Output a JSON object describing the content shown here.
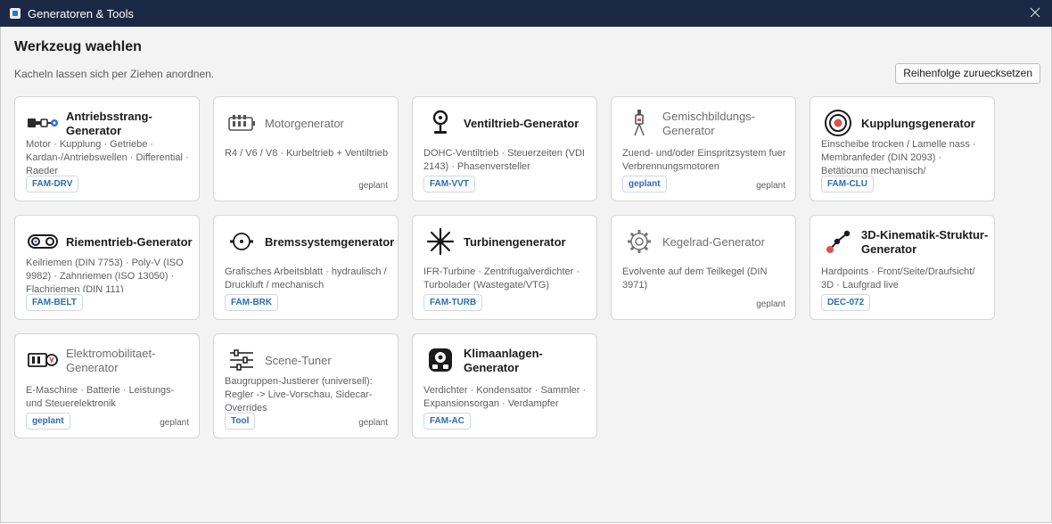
{
  "window": {
    "title": "Generatoren & Tools"
  },
  "header": {
    "title": "Werkzeug waehlen",
    "hint": "Kacheln lassen sich per Ziehen anordnen.",
    "reset_label": "Reihenfolge zuruecksetzen"
  },
  "tiles": [
    {
      "title": "Antriebsstrang-Generator",
      "desc": "Motor · Kupplung · Getriebe · Kardan-/Antriebswellen · Differential · Raeder",
      "badge": "FAM-DRV",
      "status": "",
      "icon": "drivetrain-icon",
      "planned": false
    },
    {
      "title": "Motorgenerator",
      "desc": "R4 / V6 / V8 · Kurbeltrieb + Ventiltrieb",
      "badge": "",
      "status": "geplant",
      "icon": "engine-icon",
      "planned": true
    },
    {
      "title": "Ventiltrieb-Generator",
      "desc": "DOHC-Ventiltrieb · Steuerzeiten (VDI 2143) · Phasenversteller",
      "badge": "FAM-VVT",
      "status": "",
      "icon": "valve-icon",
      "planned": false
    },
    {
      "title": "Gemischbildungs-Generator",
      "desc": "Zuend- und/oder Einspritzsystem fuer Verbrennungsmotoren",
      "badge": "geplant",
      "status": "geplant",
      "icon": "injector-icon",
      "planned": true
    },
    {
      "title": "Kupplungsgenerator",
      "desc": "Einscheibe trocken / Lamelle nass · Membranfeder (DIN 2093) · Betätigung mechanisch/",
      "badge": "FAM-CLU",
      "status": "",
      "icon": "clutch-icon",
      "planned": false
    },
    {
      "title": "Riementrieb-Generator",
      "desc": "Keilriemen (DIN 7753) · Poly-V (ISO 9982) · Zahnriemen (ISO 13050) · Flachriemen (DIN 111)",
      "badge": "FAM-BELT",
      "status": "",
      "icon": "belt-icon",
      "planned": false
    },
    {
      "title": "Bremssystemgenerator",
      "desc": "Grafisches Arbeitsblatt · hydraulisch / Druckluft / mechanisch",
      "badge": "FAM-BRK",
      "status": "",
      "icon": "brake-icon",
      "planned": false
    },
    {
      "title": "Turbinengenerator",
      "desc": "IFR-Turbine · Zentrifugalverdichter · Turbolader (Wastegate/VTG)",
      "badge": "FAM-TURB",
      "status": "",
      "icon": "turbine-icon",
      "planned": false
    },
    {
      "title": "Kegelrad-Generator",
      "desc": "Evolvente auf dem Teilkegel (DIN 3971)",
      "badge": "",
      "status": "geplant",
      "icon": "gear-icon",
      "planned": true
    },
    {
      "title": "3D-Kinematik-Struktur-Generator",
      "desc": "Hardpoints · Front/Seite/Draufsicht/ 3D · Laufgrad live",
      "badge": "DEC-072",
      "status": "",
      "icon": "kinematics-icon",
      "planned": false
    },
    {
      "title": "Elektromobilitaet-Generator",
      "desc": "E-Maschine · Batterie · Leistungs- und Steuerelektronik",
      "badge": "geplant",
      "status": "geplant",
      "icon": "electric-motor-icon",
      "planned": true
    },
    {
      "title": "Scene-Tuner",
      "desc": "Baugruppen-Justierer (universell): Regler -> Live-Vorschau, Sidecar-Overrides",
      "badge": "Tool",
      "status": "geplant",
      "icon": "sliders-icon",
      "planned": true
    },
    {
      "title": "Klimaanlagen-Generator",
      "desc": "Verdichter · Kondensator · Sammler · Expansionsorgan · Verdampfer",
      "badge": "FAM-AC",
      "status": "",
      "icon": "ac-icon",
      "planned": false
    }
  ]
}
